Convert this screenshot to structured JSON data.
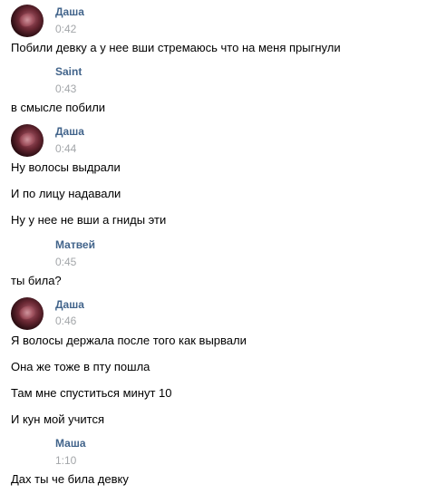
{
  "messages": [
    {
      "author": "Даша",
      "time": "0:42",
      "avatar": "avatar-photo",
      "lines": [
        "Побили девку а у нее вши стремаюсь что на меня прыгнули"
      ]
    },
    {
      "author": "Saint",
      "time": "0:43",
      "lines": [
        "в смысле побили"
      ]
    },
    {
      "author": "Даша",
      "time": "0:44",
      "avatar": "avatar-photo",
      "lines": [
        "Ну волосы выдрали",
        "И по лицу надавали",
        "Ну у нее не вши а гниды эти"
      ]
    },
    {
      "author": "Матвей",
      "time": "0:45",
      "lines": [
        "ты била?"
      ]
    },
    {
      "author": "Даша",
      "time": "0:46",
      "avatar": "avatar-photo",
      "lines": [
        "Я волосы держала после того как вырвали",
        "Она же тоже в пту пошла",
        "Там мне спуститься минут 10",
        "И кун мой учится"
      ]
    },
    {
      "author": "Маша",
      "time": "1:10",
      "lines": [
        "Дах ты че била девку"
      ]
    }
  ],
  "colors": {
    "author": "#42648b",
    "time": "#a3a6a9",
    "text": "#000000",
    "background": "#ffffff"
  }
}
